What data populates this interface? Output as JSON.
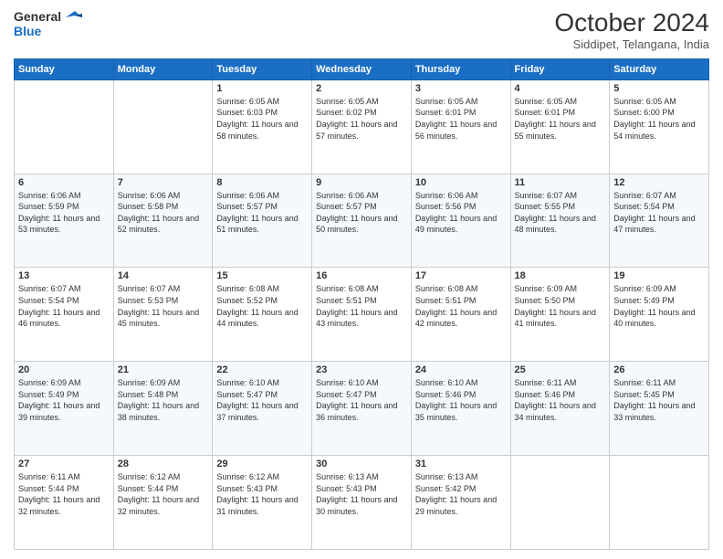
{
  "header": {
    "logo_line1": "General",
    "logo_line2": "Blue",
    "month": "October 2024",
    "location": "Siddipet, Telangana, India"
  },
  "days": [
    "Sunday",
    "Monday",
    "Tuesday",
    "Wednesday",
    "Thursday",
    "Friday",
    "Saturday"
  ],
  "weeks": [
    [
      {
        "num": "",
        "info": ""
      },
      {
        "num": "",
        "info": ""
      },
      {
        "num": "1",
        "info": "Sunrise: 6:05 AM\nSunset: 6:03 PM\nDaylight: 11 hours and 58 minutes."
      },
      {
        "num": "2",
        "info": "Sunrise: 6:05 AM\nSunset: 6:02 PM\nDaylight: 11 hours and 57 minutes."
      },
      {
        "num": "3",
        "info": "Sunrise: 6:05 AM\nSunset: 6:01 PM\nDaylight: 11 hours and 56 minutes."
      },
      {
        "num": "4",
        "info": "Sunrise: 6:05 AM\nSunset: 6:01 PM\nDaylight: 11 hours and 55 minutes."
      },
      {
        "num": "5",
        "info": "Sunrise: 6:05 AM\nSunset: 6:00 PM\nDaylight: 11 hours and 54 minutes."
      }
    ],
    [
      {
        "num": "6",
        "info": "Sunrise: 6:06 AM\nSunset: 5:59 PM\nDaylight: 11 hours and 53 minutes."
      },
      {
        "num": "7",
        "info": "Sunrise: 6:06 AM\nSunset: 5:58 PM\nDaylight: 11 hours and 52 minutes."
      },
      {
        "num": "8",
        "info": "Sunrise: 6:06 AM\nSunset: 5:57 PM\nDaylight: 11 hours and 51 minutes."
      },
      {
        "num": "9",
        "info": "Sunrise: 6:06 AM\nSunset: 5:57 PM\nDaylight: 11 hours and 50 minutes."
      },
      {
        "num": "10",
        "info": "Sunrise: 6:06 AM\nSunset: 5:56 PM\nDaylight: 11 hours and 49 minutes."
      },
      {
        "num": "11",
        "info": "Sunrise: 6:07 AM\nSunset: 5:55 PM\nDaylight: 11 hours and 48 minutes."
      },
      {
        "num": "12",
        "info": "Sunrise: 6:07 AM\nSunset: 5:54 PM\nDaylight: 11 hours and 47 minutes."
      }
    ],
    [
      {
        "num": "13",
        "info": "Sunrise: 6:07 AM\nSunset: 5:54 PM\nDaylight: 11 hours and 46 minutes."
      },
      {
        "num": "14",
        "info": "Sunrise: 6:07 AM\nSunset: 5:53 PM\nDaylight: 11 hours and 45 minutes."
      },
      {
        "num": "15",
        "info": "Sunrise: 6:08 AM\nSunset: 5:52 PM\nDaylight: 11 hours and 44 minutes."
      },
      {
        "num": "16",
        "info": "Sunrise: 6:08 AM\nSunset: 5:51 PM\nDaylight: 11 hours and 43 minutes."
      },
      {
        "num": "17",
        "info": "Sunrise: 6:08 AM\nSunset: 5:51 PM\nDaylight: 11 hours and 42 minutes."
      },
      {
        "num": "18",
        "info": "Sunrise: 6:09 AM\nSunset: 5:50 PM\nDaylight: 11 hours and 41 minutes."
      },
      {
        "num": "19",
        "info": "Sunrise: 6:09 AM\nSunset: 5:49 PM\nDaylight: 11 hours and 40 minutes."
      }
    ],
    [
      {
        "num": "20",
        "info": "Sunrise: 6:09 AM\nSunset: 5:49 PM\nDaylight: 11 hours and 39 minutes."
      },
      {
        "num": "21",
        "info": "Sunrise: 6:09 AM\nSunset: 5:48 PM\nDaylight: 11 hours and 38 minutes."
      },
      {
        "num": "22",
        "info": "Sunrise: 6:10 AM\nSunset: 5:47 PM\nDaylight: 11 hours and 37 minutes."
      },
      {
        "num": "23",
        "info": "Sunrise: 6:10 AM\nSunset: 5:47 PM\nDaylight: 11 hours and 36 minutes."
      },
      {
        "num": "24",
        "info": "Sunrise: 6:10 AM\nSunset: 5:46 PM\nDaylight: 11 hours and 35 minutes."
      },
      {
        "num": "25",
        "info": "Sunrise: 6:11 AM\nSunset: 5:46 PM\nDaylight: 11 hours and 34 minutes."
      },
      {
        "num": "26",
        "info": "Sunrise: 6:11 AM\nSunset: 5:45 PM\nDaylight: 11 hours and 33 minutes."
      }
    ],
    [
      {
        "num": "27",
        "info": "Sunrise: 6:11 AM\nSunset: 5:44 PM\nDaylight: 11 hours and 32 minutes."
      },
      {
        "num": "28",
        "info": "Sunrise: 6:12 AM\nSunset: 5:44 PM\nDaylight: 11 hours and 32 minutes."
      },
      {
        "num": "29",
        "info": "Sunrise: 6:12 AM\nSunset: 5:43 PM\nDaylight: 11 hours and 31 minutes."
      },
      {
        "num": "30",
        "info": "Sunrise: 6:13 AM\nSunset: 5:43 PM\nDaylight: 11 hours and 30 minutes."
      },
      {
        "num": "31",
        "info": "Sunrise: 6:13 AM\nSunset: 5:42 PM\nDaylight: 11 hours and 29 minutes."
      },
      {
        "num": "",
        "info": ""
      },
      {
        "num": "",
        "info": ""
      }
    ]
  ]
}
